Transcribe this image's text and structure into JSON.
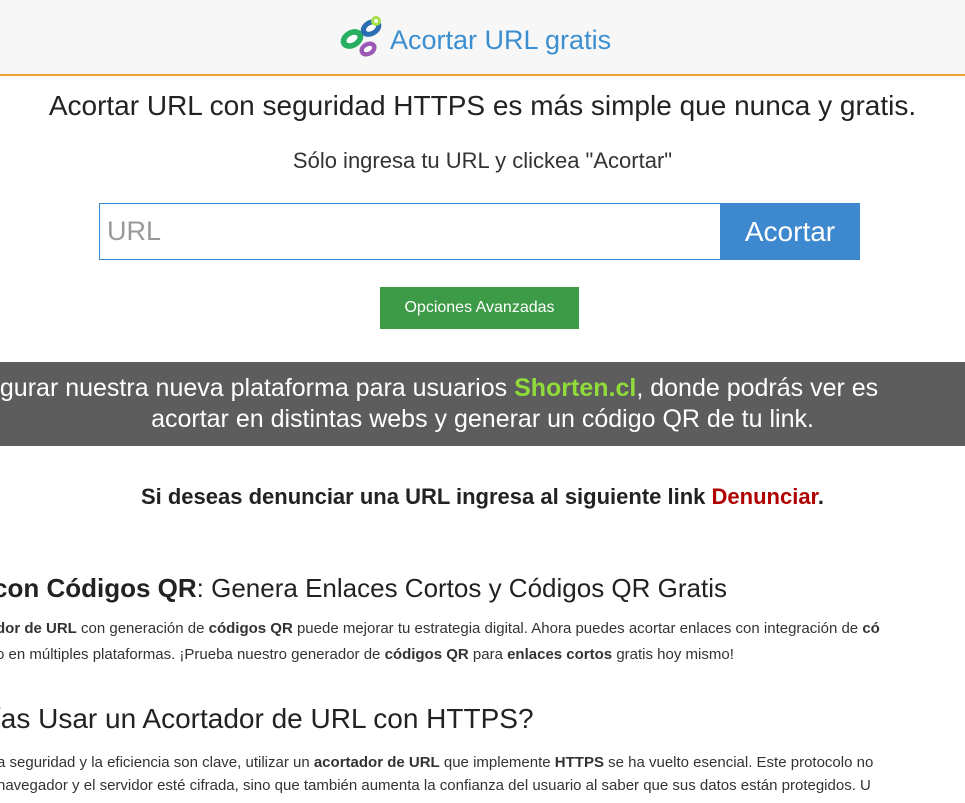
{
  "header": {
    "brand_name": "Acortar URL gratis",
    "logo_icon": "chain-link-icon",
    "accent_color": "#f0a030"
  },
  "hero": {
    "headline": "Acortar URL con seguridad HTTPS es más simple que nunca y gratis.",
    "subline": "Sólo ingresa tu URL y clickea \"Acortar\""
  },
  "form": {
    "url_placeholder": "URL",
    "url_value": "",
    "shorten_label": "Acortar",
    "advanced_label": "Opciones Avanzadas"
  },
  "banner": {
    "line1_before": "ugurar nuestra nueva plataforma para usuarios ",
    "line1_highlight": "Shorten.cl",
    "line1_after": ", donde podrás ver es",
    "line2": "acortar en distintas webs y generar un código QR de tu link."
  },
  "report": {
    "text": "Si deseas denunciar una URL ingresa al siguiente link ",
    "link_label": "Denunciar",
    "end": "."
  },
  "section_qr": {
    "title_bold": " con Códigos QR",
    "title_rest": ": Genera Enlaces Cortos y Códigos QR Gratis",
    "p1": [
      {
        "t": "dor de URL",
        "b": true
      },
      {
        "t": " con generación de ",
        "b": false
      },
      {
        "t": "códigos QR",
        "b": true
      },
      {
        "t": " puede mejorar tu estrategia digital. Ahora puedes acortar enlaces con integración de ",
        "b": false
      },
      {
        "t": "có",
        "b": true
      }
    ],
    "p2": [
      {
        "t": "o en múltiples plataformas. ¡Prueba nuestro generador de ",
        "b": false
      },
      {
        "t": "códigos QR",
        "b": true
      },
      {
        "t": " para ",
        "b": false
      },
      {
        "t": "enlaces cortos",
        "b": true
      },
      {
        "t": " gratis hoy mismo!",
        "b": false
      }
    ]
  },
  "section_https": {
    "title": "ías Usar un Acortador de URL con HTTPS?",
    "p1": [
      {
        "t": "a seguridad y la eficiencia son clave, utilizar un ",
        "b": false
      },
      {
        "t": "acortador de URL",
        "b": true
      },
      {
        "t": " que implemente ",
        "b": false
      },
      {
        "t": "HTTPS",
        "b": true
      },
      {
        "t": " se ha vuelto esencial. Este protocolo no",
        "b": false
      }
    ],
    "p2": [
      {
        "t": " navegador y el servidor esté cifrada, sino que también aumenta la confianza del usuario al saber que sus datos están protegidos. U",
        "b": false
      }
    ]
  }
}
